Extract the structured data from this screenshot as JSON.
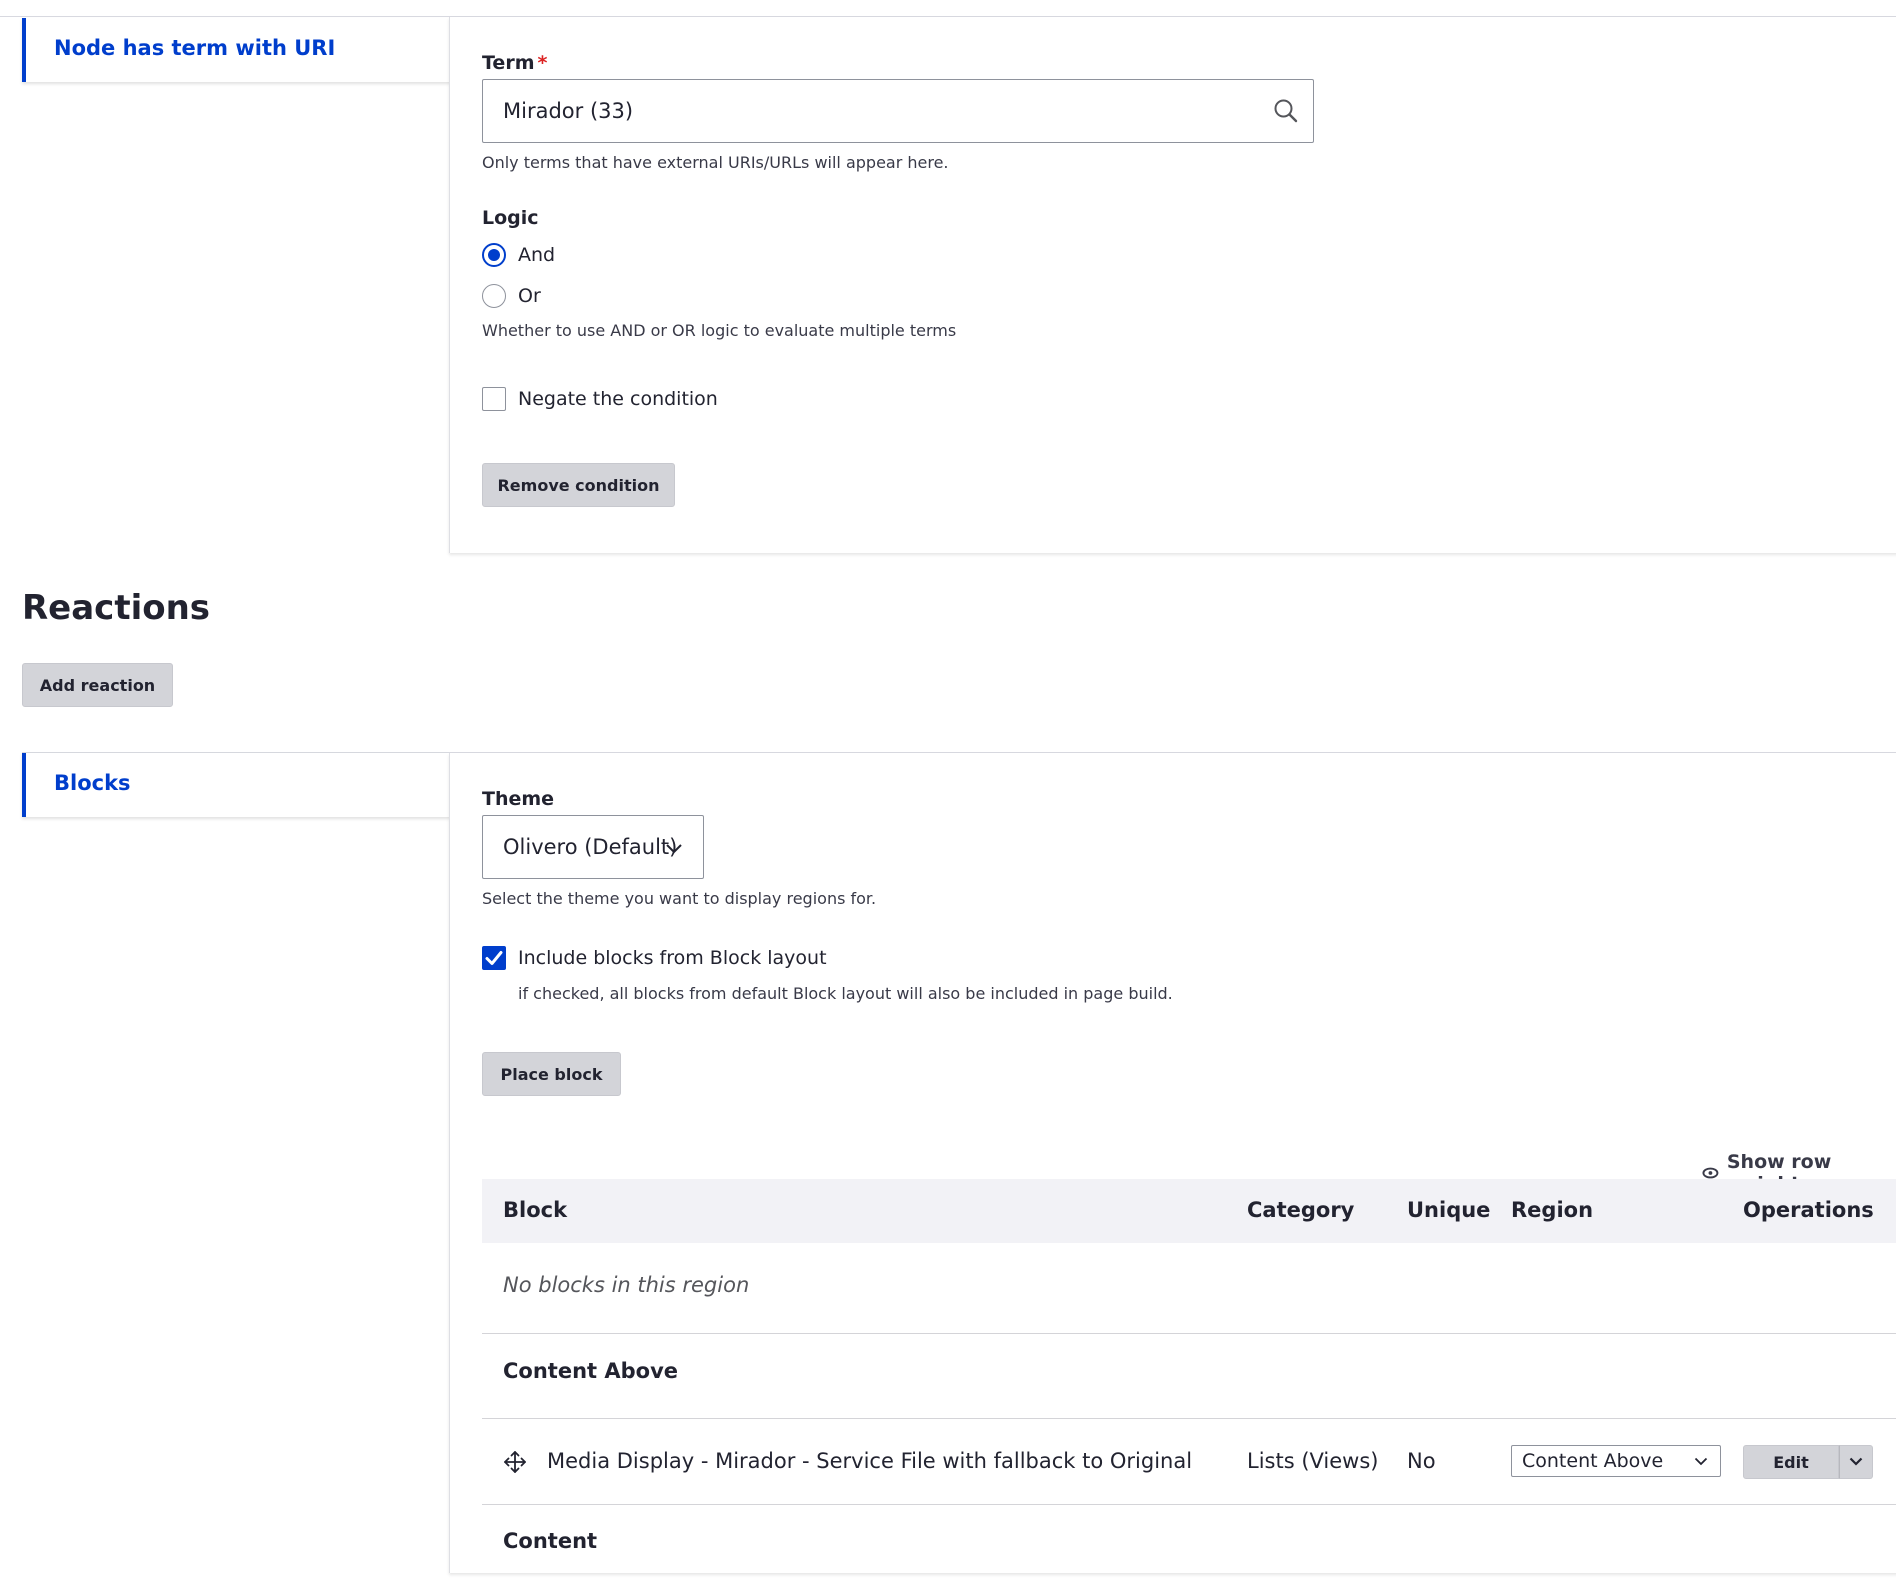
{
  "conditions": {
    "tab_label": "Node has term with URI",
    "term": {
      "label": "Term",
      "required_marker": "*",
      "value": "Mirador (33)",
      "description": "Only terms that have external URIs/URLs will appear here."
    },
    "logic": {
      "label": "Logic",
      "options": [
        {
          "label": "And",
          "selected": true
        },
        {
          "label": "Or",
          "selected": false
        }
      ],
      "description": "Whether to use AND or OR logic to evaluate multiple terms"
    },
    "negate": {
      "label": "Negate the condition",
      "checked": false
    },
    "remove_button": "Remove condition"
  },
  "reactions": {
    "heading": "Reactions",
    "add_button": "Add reaction"
  },
  "blocks": {
    "tab_label": "Blocks",
    "theme": {
      "label": "Theme",
      "value": "Olivero (Default)",
      "description": "Select the theme you want to display regions for."
    },
    "include_blocks": {
      "label": "Include blocks from Block layout",
      "checked": true,
      "description": "if checked, all blocks from default Block layout will also be included in page build."
    },
    "place_button": "Place block",
    "show_row_weights": "Show row weights",
    "table": {
      "headers": [
        "Block",
        "Category",
        "Unique",
        "Region",
        "Operations"
      ],
      "empty_message": "No blocks in this region",
      "regions": [
        {
          "name": "Content Above",
          "rows": [
            {
              "block": "Media Display - Mirador - Service File with fallback to Original",
              "category": "Lists (Views)",
              "unique": "No",
              "region": "Content Above",
              "operation": "Edit"
            }
          ]
        },
        {
          "name": "Content",
          "rows": []
        }
      ]
    }
  },
  "colors": {
    "accent": "#003ecc",
    "required": "#dc2323",
    "button_bg": "#d3d4d9",
    "table_header_bg": "#f2f2f6"
  }
}
